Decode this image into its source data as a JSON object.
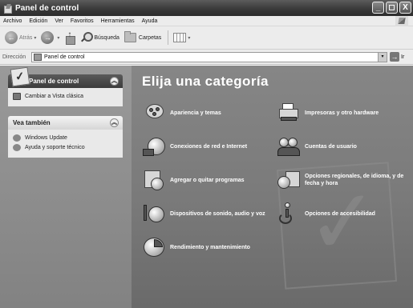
{
  "window": {
    "title": "Panel de control",
    "buttons": {
      "minimize": "_",
      "maximize": "◻",
      "close": "X"
    }
  },
  "menu": [
    "Archivo",
    "Edición",
    "Ver",
    "Favoritos",
    "Herramientas",
    "Ayuda"
  ],
  "toolbar": {
    "back_label": "Atrás",
    "search_label": "Búsqueda",
    "folders_label": "Carpetas"
  },
  "address": {
    "label": "Dirección",
    "value": "Panel de control",
    "go_label": "Ir"
  },
  "sidebar": {
    "control_panel": {
      "title": "Panel de control",
      "links": [
        "Cambiar a Vista clásica"
      ]
    },
    "see_also": {
      "title": "Vea también",
      "links": [
        "Windows Update",
        "Ayuda y soporte técnico"
      ]
    }
  },
  "main": {
    "heading": "Elija una categoría",
    "categories": [
      "Apariencia y temas",
      "Impresoras y otro hardware",
      "Conexiones de red e Internet",
      "Cuentas de usuario",
      "Agregar o quitar programas",
      "Opciones regionales, de idioma, y de fecha y hora",
      "Dispositivos de sonido, audio y voz",
      "Opciones de accesibilidad",
      "Rendimiento y mantenimiento"
    ]
  }
}
